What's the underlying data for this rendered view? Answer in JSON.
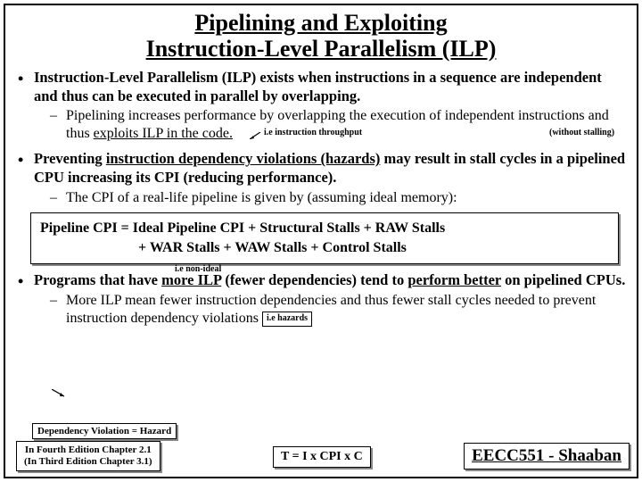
{
  "title_l1": "Pipelining and Exploiting",
  "title_l2": "Instruction-Level Parallelism (ILP)",
  "b1_text": "Instruction-Level Parallelism (ILP) exists when instructions in a sequence are independent and thus can be executed in parallel by overlapping.",
  "annot_throughput": "i.e instruction throughput",
  "annot_stalling": "(without stalling)",
  "b1_sub": "Pipelining increases performance by overlapping the execution of independent instructions and thus ",
  "b1_sub_u": "exploits ILP in the code.",
  "b2_a": "Preventing ",
  "b2_u": "instruction dependency violations (hazards)",
  "b2_b": " may result in stall cycles in a pipelined CPU increasing its CPI (reducing performance).",
  "b2_sub": "The CPI of a real-life pipeline is given by (assuming ideal memory):",
  "annot_nonideal": "i.e non-ideal",
  "formula_l1": "Pipeline CPI = Ideal Pipeline CPI + Structural Stalls + RAW Stalls",
  "formula_l2": "+ WAR Stalls + WAW Stalls + Control Stalls",
  "b3_a": "Programs that have ",
  "b3_u1": "more ILP",
  "b3_b": " (fewer dependencies) tend to ",
  "b3_u2": "perform better",
  "b3_c": " on pipelined CPUs.",
  "b3_sub": "More ILP mean fewer instruction dependencies and thus fewer stall cycles needed to prevent instruction dependency violations ",
  "hazards_note": "i.e hazards",
  "dep_hazard": "Dependency Violation = Hazard",
  "edition_l1": "In Fourth Edition Chapter 2.1",
  "edition_l2": "(In Third Edition Chapter 3.1)",
  "tcpi": "T = I x CPI x C",
  "course": "EECC551 - Shaaban"
}
